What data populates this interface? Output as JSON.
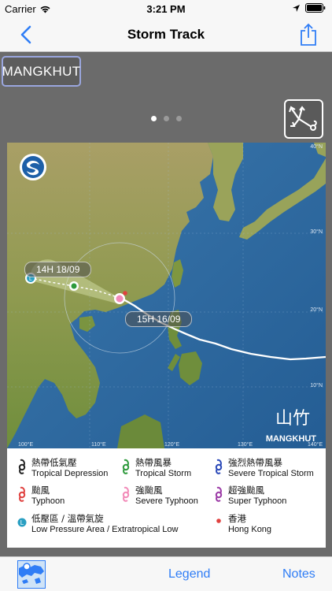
{
  "status_bar": {
    "carrier": "Carrier",
    "time": "3:21 PM"
  },
  "nav": {
    "title": "Storm Track",
    "back_icon": "chevron-left-icon",
    "share_icon": "share-icon"
  },
  "storm": {
    "name": "MANGKHUT",
    "name_chinese": "山竹",
    "name_english": "MANGKHUT"
  },
  "pager": {
    "pages": 3,
    "current": 1
  },
  "map": {
    "label_latest": "14H 18/09",
    "label_earliest": "15H 16/09",
    "lat_ticks": [
      "40°N",
      "30°N",
      "20°N",
      "10°N"
    ],
    "lon_ticks": [
      "100°E",
      "110°E",
      "120°E",
      "130°E",
      "140°E"
    ]
  },
  "legend": {
    "items": [
      {
        "zh": "熱帶低氣壓",
        "en": "Tropical Depression",
        "color": "#222222",
        "symbol": "cyclone"
      },
      {
        "zh": "熱帶風暴",
        "en": "Tropical Storm",
        "color": "#2e9a3c",
        "symbol": "cyclone"
      },
      {
        "zh": "強烈熱帶風暴",
        "en": "Severe Tropical Storm",
        "color": "#2b49b8",
        "symbol": "cyclone"
      },
      {
        "zh": "颱風",
        "en": "Typhoon",
        "color": "#e0413f",
        "symbol": "cyclone"
      },
      {
        "zh": "強颱風",
        "en": "Severe Typhoon",
        "color": "#f28ab8",
        "symbol": "cyclone"
      },
      {
        "zh": "超強颱風",
        "en": "Super Typhoon",
        "color": "#9b3aa6",
        "symbol": "cyclone"
      },
      {
        "zh": "低壓區 / 溫帶氣旋",
        "en": "Low Pressure Area / Extratropical Low",
        "color": "#2a9fc2",
        "symbol": "low"
      },
      {
        "zh": "香港",
        "en": "Hong Kong",
        "color": "#e0413f",
        "symbol": "dot"
      }
    ]
  },
  "toolbar": {
    "map_icon": "hk-map-icon",
    "legend_label": "Legend",
    "notes_label": "Notes"
  },
  "colors": {
    "accent": "#2f7df6",
    "background": "#6b6b6b",
    "badge_border": "#9aa6de",
    "track_line": "#ffffff"
  }
}
